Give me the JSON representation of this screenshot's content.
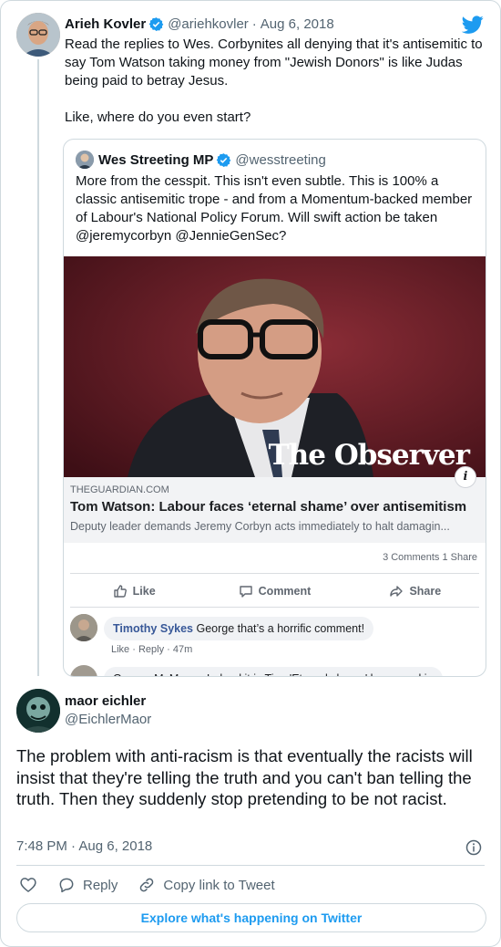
{
  "parent_tweet": {
    "display_name": "Arieh Kovler",
    "handle": "@ariehkovler",
    "date_sep": "·",
    "date": "Aug 6, 2018",
    "text_1": "Read the replies to Wes.  Corbynites all denying that it's antisemitic to say Tom Watson taking money from \"Jewish Donors\" is like Judas being paid to betray Jesus.",
    "text_2": "Like, where do you even start?"
  },
  "quoted_tweet": {
    "display_name": "Wes Streeting MP",
    "handle": "@wesstreeting",
    "text": "More from the cesspit. This isn't even subtle. This is 100% a classic antisemitic trope - and from a Momentum-backed member of Labour's National Policy Forum. Will swift action be taken @jeremycorbyn @JennieGenSec?",
    "image_watermark": "The Observer",
    "link_card": {
      "domain": "THEGUARDIAN.COM",
      "title": "Tom Watson: Labour faces ‘eternal shame’ over antisemitism",
      "description": "Deputy leader demands Jeremy Corbyn acts immediately to halt damagin...",
      "info_glyph": "i"
    },
    "facebook": {
      "counts": "3 Comments  1 Share",
      "actions": {
        "like": "Like",
        "comment": "Comment",
        "share": "Share"
      },
      "comment_author": "Timothy Sykes",
      "comment_text": " George that’s a horrific comment!",
      "comment_meta": "Like · Reply · 47m",
      "comment2_text": "George McManus Indeed it is Tim. 'Eternal shame' happened in"
    }
  },
  "main_tweet": {
    "display_name": "maor eichler",
    "handle": "@EichlerMaor",
    "text": "The problem with anti-racism is that eventually the racists will insist that they're telling the truth and you can't ban telling the truth.  Then they suddenly stop pretending to be not racist.",
    "timestamp": "7:48 PM · Aug 6, 2018",
    "actions": {
      "reply": "Reply",
      "copy_link": "Copy link to Tweet"
    },
    "explore_label": "Explore what's happening on Twitter"
  },
  "colors": {
    "twitter_blue": "#1d9bf0",
    "text_primary": "#0f1419",
    "text_muted": "#536471",
    "border": "#cfd9de",
    "fb_link": "#385898"
  },
  "icons": {
    "verified": "verified-badge-icon",
    "logo": "twitter-bird-icon",
    "like": "heart-icon",
    "reply": "speech-bubble-icon",
    "link": "chain-link-icon",
    "info": "info-circle-icon"
  }
}
